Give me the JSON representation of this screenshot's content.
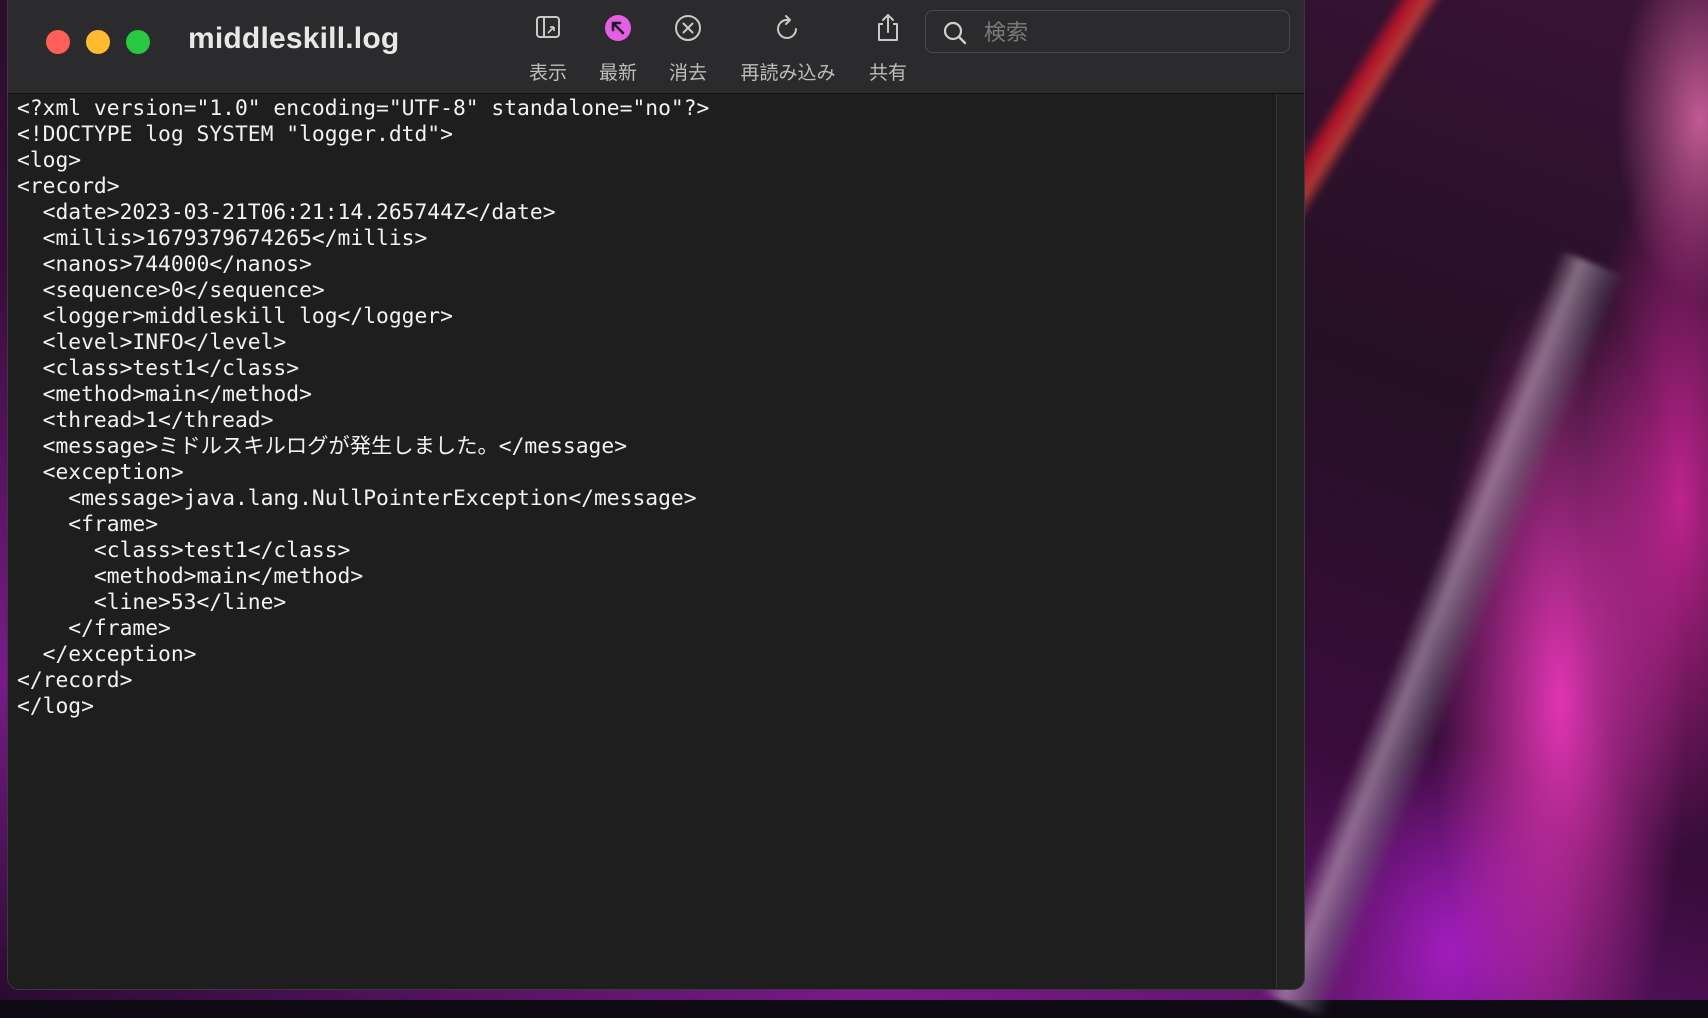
{
  "window": {
    "title": "middleskill.log",
    "traffic_lights": {
      "close": "#ff5f57",
      "minimize": "#febc2e",
      "maximize": "#28c840"
    }
  },
  "toolbar": {
    "show_label": "表示",
    "latest_label": "最新",
    "clear_label": "消去",
    "reload_label": "再読み込み",
    "share_label": "共有",
    "latest_accent": "#e55ee6"
  },
  "search": {
    "placeholder": "検索",
    "value": ""
  },
  "log": {
    "lines": [
      "<?xml version=\"1.0\" encoding=\"UTF-8\" standalone=\"no\"?>",
      "<!DOCTYPE log SYSTEM \"logger.dtd\">",
      "<log>",
      "<record>",
      "  <date>2023-03-21T06:21:14.265744Z</date>",
      "  <millis>1679379674265</millis>",
      "  <nanos>744000</nanos>",
      "  <sequence>0</sequence>",
      "  <logger>middleskill log</logger>",
      "  <level>INFO</level>",
      "  <class>test1</class>",
      "  <method>main</method>",
      "  <thread>1</thread>",
      "  <message>ミドルスキルログが発生しました。</message>",
      "  <exception>",
      "    <message>java.lang.NullPointerException</message>",
      "    <frame>",
      "      <class>test1</class>",
      "      <method>main</method>",
      "      <line>53</line>",
      "    </frame>",
      "  </exception>",
      "</record>",
      "</log>"
    ]
  }
}
